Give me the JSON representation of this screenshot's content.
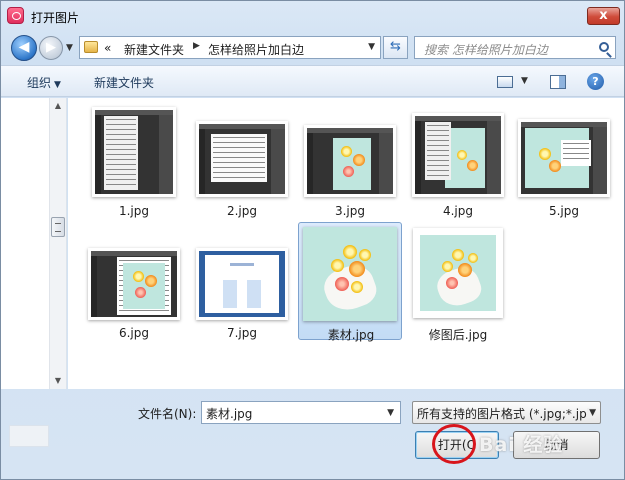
{
  "window": {
    "title": "打开图片",
    "close_label": "x"
  },
  "nav": {
    "back_label": "◀",
    "forward_label": "▶",
    "breadcrumbs": [
      "«",
      "新建文件夹",
      "怎样给照片加白边"
    ],
    "search_placeholder": "搜索 怎样给照片加白边"
  },
  "toolbar": {
    "organize": "组织",
    "new_folder": "新建文件夹",
    "help": "?"
  },
  "files": [
    {
      "name": "1.jpg",
      "thumb": "ps-menu"
    },
    {
      "name": "2.jpg",
      "thumb": "ps-dialog"
    },
    {
      "name": "3.jpg",
      "thumb": "ps-photo"
    },
    {
      "name": "4.jpg",
      "thumb": "ps-menu-photo"
    },
    {
      "name": "5.jpg",
      "thumb": "ps-dialog-photo"
    },
    {
      "name": "6.jpg",
      "thumb": "ps-white-border"
    },
    {
      "name": "7.jpg",
      "thumb": "web-page"
    },
    {
      "name": "素材.jpg",
      "thumb": "food-photo",
      "selected": true
    },
    {
      "name": "修图后.jpg",
      "thumb": "food-photo-white-border"
    }
  ],
  "footer": {
    "filename_label": "文件名(N):",
    "filename_value": "素材.jpg",
    "filetype_value": "所有支持的图片格式 (*.jpg;*.jp",
    "open_label": "打开(O",
    "cancel_label": "取消"
  },
  "watermark": "Bai 经验",
  "colors": {
    "photo_bg": "#bfe6de",
    "selection": "#c3dcf5",
    "annotation_circle": "#d8151b"
  }
}
